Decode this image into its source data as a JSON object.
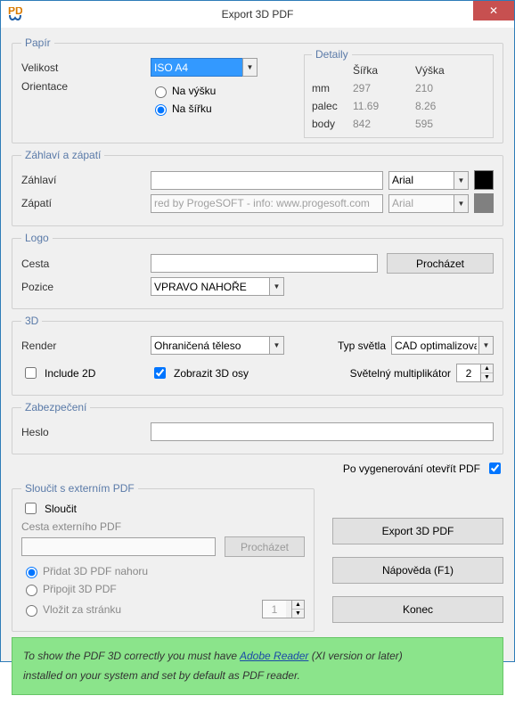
{
  "title": "Export 3D PDF",
  "paper": {
    "legend": "Papír",
    "size_label": "Velikost",
    "size_value": "ISO A4",
    "orient_label": "Orientace",
    "orient_portrait": "Na výšku",
    "orient_landscape": "Na šířku"
  },
  "details": {
    "legend": "Detaily",
    "width_hdr": "Šířka",
    "height_hdr": "Výška",
    "rows": [
      {
        "unit": "mm",
        "w": "297",
        "h": "210"
      },
      {
        "unit": "palec",
        "w": "11.69",
        "h": "8.26"
      },
      {
        "unit": "body",
        "w": "842",
        "h": "595"
      }
    ]
  },
  "hf": {
    "legend": "Záhlaví a zápatí",
    "header_label": "Záhlaví",
    "footer_label": "Zápatí",
    "header_value": "",
    "footer_value": "red by ProgeSOFT - info: www.progesoft.com",
    "font_header": "Arial",
    "font_footer": "Arial",
    "color_header": "#000000",
    "color_footer": "#808080"
  },
  "logo": {
    "legend": "Logo",
    "path_label": "Cesta",
    "path_value": "",
    "browse": "Procházet",
    "pos_label": "Pozice",
    "pos_value": "VPRAVO NAHOŘE"
  },
  "three_d": {
    "legend": "3D",
    "render_label": "Render",
    "render_value": "Ohraničená těleso",
    "light_type_label": "Typ světla",
    "light_type_value": "CAD optimalizovar",
    "include2d": "Include 2D",
    "show_axes": "Zobrazit 3D osy",
    "light_mult_label": "Světelný multiplikátor",
    "light_mult_value": "2"
  },
  "security": {
    "legend": "Zabezpečení",
    "pwd_label": "Heslo",
    "pwd_value": ""
  },
  "post_open": "Po vygenerování otevřít PDF",
  "merge": {
    "legend": "Sloučit s externím PDF",
    "merge_chk": "Sloučit",
    "path_label": "Cesta externího PDF",
    "path_value": "",
    "browse": "Procházet",
    "opt_top": "Přidat 3D PDF nahoru",
    "opt_append": "Připojit 3D PDF",
    "opt_insert": "Vložit za stránku",
    "page_value": "1"
  },
  "buttons": {
    "export": "Export 3D PDF",
    "help": "Nápověda (F1)",
    "close": "Konec"
  },
  "footer": {
    "pre": "To show the PDF 3D correctly you must have ",
    "link": "Adobe Reader",
    "mid": " (XI version or later)",
    "post": "installed on your system and set by default as PDF reader."
  }
}
